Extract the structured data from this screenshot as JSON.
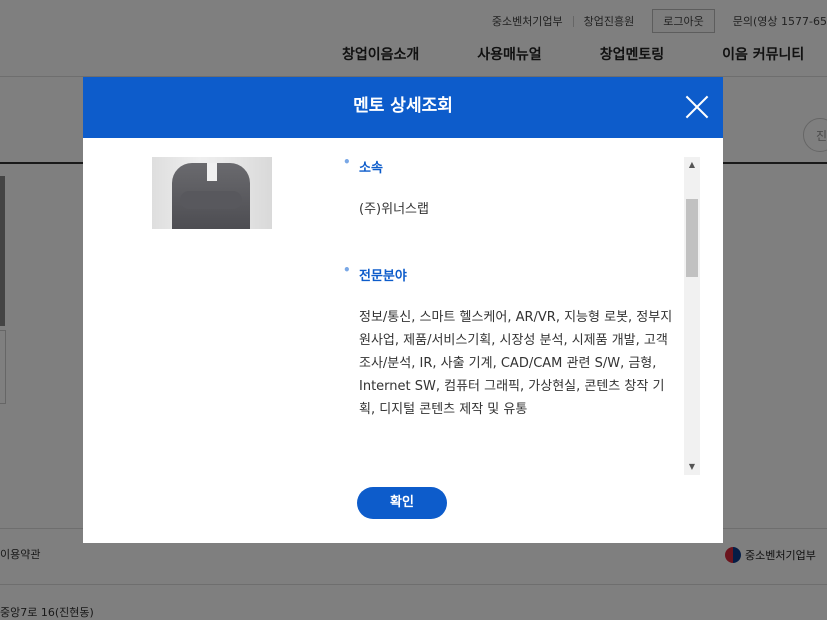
{
  "header": {
    "utility": {
      "ministry": "중소벤처기업부",
      "agency": "창업진흥원",
      "logout": "로그아웃",
      "contact": "문의(영상 1577-65"
    },
    "nav": [
      "창업이음소개",
      "사용매뉴얼",
      "창업멘토링",
      "이음 커뮤니티"
    ],
    "search_stub": "진"
  },
  "footer": {
    "terms": "이용약관",
    "logo_text": "중소벤처기업부",
    "address": "중앙7로 16(진현동)"
  },
  "modal": {
    "title": "멘토 상세조회",
    "sections": [
      {
        "label": "소속",
        "text": "(주)위너스랩"
      },
      {
        "label": "전문분야",
        "text": "정보/통신, 스마트 헬스케어, AR/VR, 지능형 로봇, 정부지원사업, 제품/서비스기획, 시장성 분석, 시제품 개발, 고객조사/분석, IR, 사출 기계, CAD/CAM 관련 S/W, 금형, Internet SW, 컴퓨터 그래픽, 가상현실, 콘텐츠 창작 기획, 디지털 콘텐츠 제작 및 유통"
      }
    ],
    "confirm_label": "확인"
  },
  "icons": {
    "close": "close-icon",
    "bullet": "•",
    "scroll_up": "▲",
    "scroll_down": "▼"
  },
  "colors": {
    "accent": "#0d5ccb",
    "overlay": "rgba(0,0,0,0.5)"
  }
}
